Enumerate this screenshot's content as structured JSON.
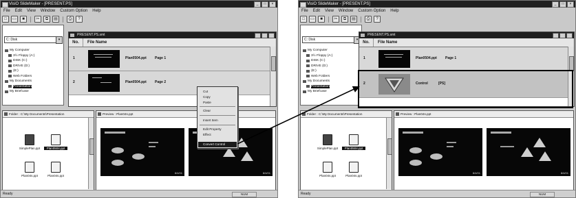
{
  "left": {
    "title": "VisiO SlideMaker - [PRESENT.PS]",
    "menu": [
      "File",
      "Edit",
      "View",
      "Window",
      "Custom Option",
      "Help"
    ],
    "drive": "C: Disk",
    "tree": [
      "My Computer",
      "3½ Floppy (A:)",
      "DISK (C:)",
      "DRIVE (D:)",
      "(E:)",
      "Web Folders",
      "My Documents",
      "Presentation",
      "My Briefcase"
    ],
    "doc_title": "PRESENT.PS.smt",
    "col_no": "No.",
    "col_name": "File Name",
    "rows": [
      {
        "no": "1",
        "name": "Plan0504.ppt",
        "page": "Page 1"
      },
      {
        "no": "2",
        "name": "Plan0504.ppt",
        "page": "Page 2"
      }
    ],
    "context_menu": [
      "Cut",
      "Copy",
      "Paste",
      "Clear",
      "Insert Item",
      "Edit Property",
      "Effect",
      "Convert Control"
    ],
    "folder_header": "Folder : C:\\My Documents\\Presentation",
    "preview_header": "Preview : Plan04s.ppt",
    "files": [
      "SimplePlan.ppt",
      "Plan0504.ppt",
      "Plan04s.ppt",
      "Plan04s.ppt"
    ],
    "slide_number": "8/4/01",
    "status": "Ready",
    "status_num": "NUM"
  },
  "right": {
    "title": "VisiO SlideMaker - [PRESENT.PS]",
    "menu": [
      "File",
      "Edit",
      "View",
      "Window",
      "Custom Option",
      "Help"
    ],
    "drive": "C: Disk",
    "tree": [
      "My Computer",
      "3½ Floppy (A:)",
      "DISK (C:)",
      "DRIVE (D:)",
      "(E:)",
      "Web Folders",
      "My Documents",
      "Presentation",
      "My Briefcase"
    ],
    "doc_title": "PRESENT.PS.smt",
    "col_no": "No.",
    "col_name": "File Name",
    "rows": [
      {
        "no": "1",
        "name": "Plan0504.ppt",
        "page": "Page 1"
      },
      {
        "no": "2",
        "name": "Control",
        "page": "[PS]"
      }
    ],
    "folder_header": "Folder : C:\\My Documents\\Presentation",
    "preview_header": "Preview : Plan04s.ppt",
    "files": [
      "SimplePlan.ppt",
      "Plan0504.ppt",
      "Plan04s.ppt",
      "Plan04s.ppt"
    ],
    "slide_number": "8/4/01",
    "status": "Ready",
    "status_num": "NUM"
  },
  "colors": {
    "accent_dark": "#1e1e1e",
    "window_bg": "#c9c9c9",
    "highlight_border": "#000000"
  }
}
